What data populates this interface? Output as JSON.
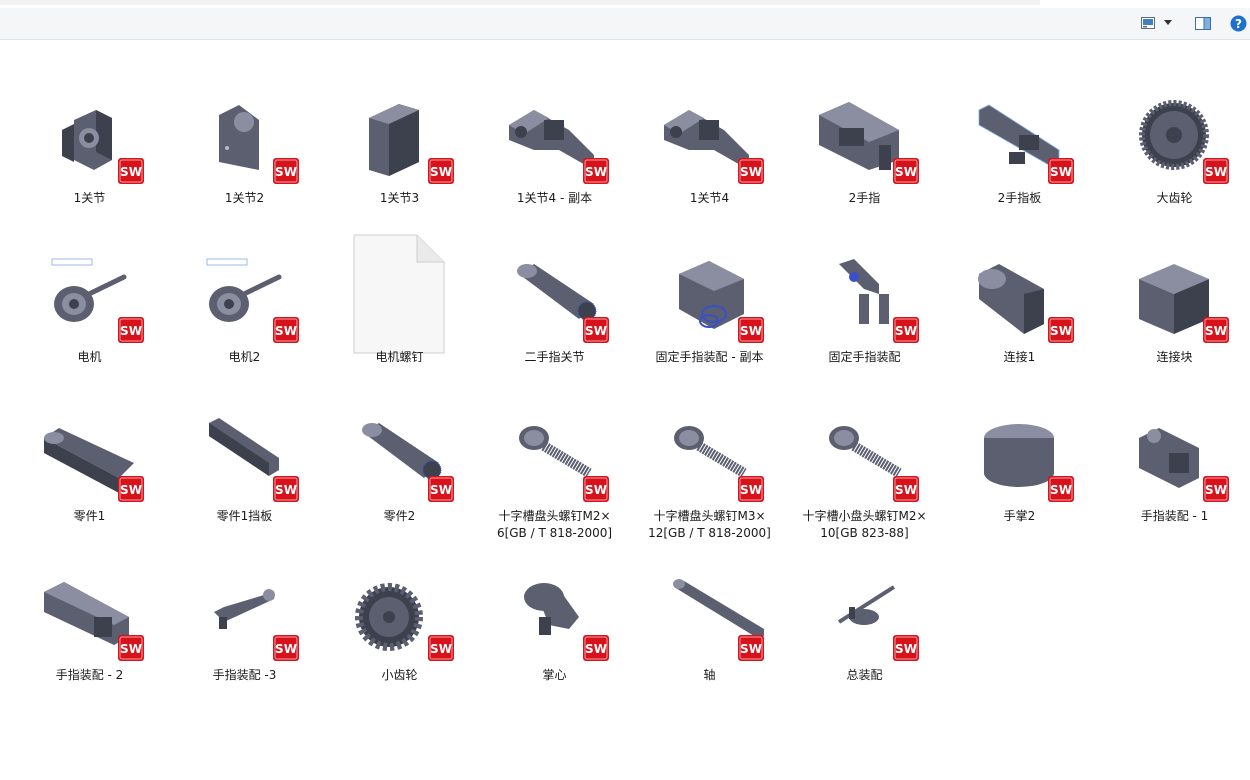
{
  "toolbar": {
    "buttons": [
      {
        "icon": "change-view-icon"
      },
      {
        "icon": "view-options-dropdown-icon"
      },
      {
        "icon": "preview-pane-icon"
      },
      {
        "icon": "help-icon",
        "glyph": "?"
      }
    ]
  },
  "badge": {
    "text": "SW",
    "color": "#d7121b"
  },
  "files": [
    {
      "label": "1关节",
      "kind": "joint1"
    },
    {
      "label": "1关节2",
      "kind": "joint1b"
    },
    {
      "label": "1关节3",
      "kind": "block"
    },
    {
      "label": "1关节4 - 副本",
      "kind": "arm"
    },
    {
      "label": "1关节4",
      "kind": "arm"
    },
    {
      "label": "2手指",
      "kind": "finger"
    },
    {
      "label": "2手指板",
      "kind": "plate"
    },
    {
      "label": "大齿轮",
      "kind": "biggear"
    },
    {
      "label": "电机",
      "kind": "motor"
    },
    {
      "label": "电机2",
      "kind": "motor"
    },
    {
      "label": "电机螺钉",
      "kind": "blankfile"
    },
    {
      "label": "二手指关节",
      "kind": "link"
    },
    {
      "label": "固定手指装配 - 副本",
      "kind": "assembly"
    },
    {
      "label": "固定手指装配",
      "kind": "assembly2"
    },
    {
      "label": "连接1",
      "kind": "connector"
    },
    {
      "label": "连接块",
      "kind": "cube"
    },
    {
      "label": "零件1",
      "kind": "part1"
    },
    {
      "label": "零件1挡板",
      "kind": "flatplate"
    },
    {
      "label": "零件2",
      "kind": "link"
    },
    {
      "label": "十字槽盘头螺钉M2×\n6[GB / T 818-2000]",
      "kind": "screw"
    },
    {
      "label": "十字槽盘头螺钉M3×\n12[GB / T 818-2000]",
      "kind": "screw"
    },
    {
      "label": "十字槽小盘头螺钉M2×\n10[GB 823-88]",
      "kind": "screw"
    },
    {
      "label": "手掌2",
      "kind": "cylinder"
    },
    {
      "label": "手指装配 - 1",
      "kind": "fingerasm"
    },
    {
      "label": "手指装配 - 2",
      "kind": "fingerasm2"
    },
    {
      "label": "手指装配 -3",
      "kind": "smalllink"
    },
    {
      "label": "小齿轮",
      "kind": "smallgear"
    },
    {
      "label": "掌心",
      "kind": "palm"
    },
    {
      "label": "轴",
      "kind": "shaft"
    },
    {
      "label": "总装配",
      "kind": "totalasm"
    }
  ]
}
